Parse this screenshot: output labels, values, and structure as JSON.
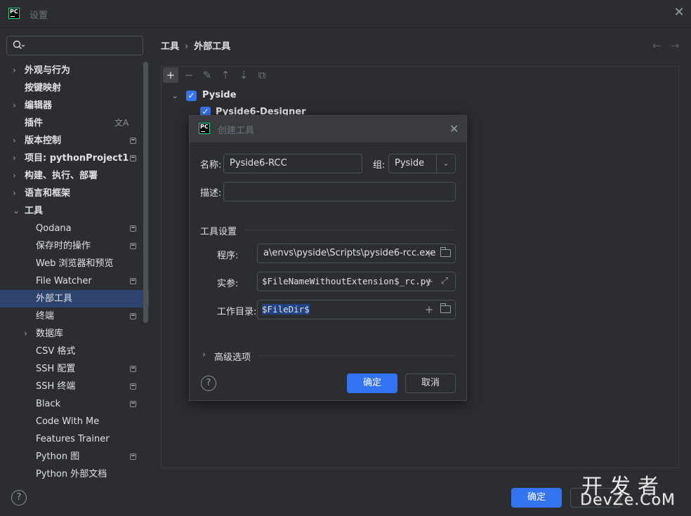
{
  "window": {
    "title": "设置",
    "close_icon": "close-icon"
  },
  "search": {
    "placeholder": "",
    "icon": "search-icon"
  },
  "sidebar": {
    "items": [
      {
        "label": "外观与行为",
        "expandable": true,
        "expanded": false,
        "level": 0
      },
      {
        "label": "按键映射",
        "expandable": false,
        "level": 0
      },
      {
        "label": "编辑器",
        "expandable": true,
        "expanded": false,
        "level": 0
      },
      {
        "label": "插件",
        "expandable": false,
        "level": 0,
        "icon": "translate-icon"
      },
      {
        "label": "版本控制",
        "expandable": true,
        "expanded": false,
        "level": 0,
        "badge": true
      },
      {
        "label": "项目: pythonProject1",
        "expandable": true,
        "expanded": false,
        "level": 0,
        "badge": true
      },
      {
        "label": "构建、执行、部署",
        "expandable": true,
        "expanded": false,
        "level": 0
      },
      {
        "label": "语言和框架",
        "expandable": true,
        "expanded": false,
        "level": 0
      },
      {
        "label": "工具",
        "expandable": true,
        "expanded": true,
        "level": 0
      },
      {
        "label": "Qodana",
        "level": 1,
        "badge": true
      },
      {
        "label": "保存时的操作",
        "level": 1,
        "badge": true
      },
      {
        "label": "Web 浏览器和预览",
        "level": 1
      },
      {
        "label": "File Watcher",
        "level": 1,
        "badge": true
      },
      {
        "label": "外部工具",
        "level": 1,
        "selected": true
      },
      {
        "label": "终端",
        "level": 1,
        "badge": true
      },
      {
        "label": "数据库",
        "level": 1,
        "expandable": true,
        "expanded": false
      },
      {
        "label": "CSV 格式",
        "level": 1
      },
      {
        "label": "SSH 配置",
        "level": 1,
        "badge": true
      },
      {
        "label": "SSH 终端",
        "level": 1,
        "badge": true
      },
      {
        "label": "Black",
        "level": 1,
        "badge": true
      },
      {
        "label": "Code With Me",
        "level": 1
      },
      {
        "label": "Features Trainer",
        "level": 1
      },
      {
        "label": "Python 图",
        "level": 1,
        "badge": true
      },
      {
        "label": "Python 外部文档",
        "level": 1
      }
    ]
  },
  "breadcrumb": {
    "parent": "工具",
    "current": "外部工具"
  },
  "toolbar": {
    "add": "+",
    "remove": "−",
    "edit": "✎",
    "up": "⇡",
    "down": "⇣",
    "copy": "⧉"
  },
  "tools_tree": {
    "group": {
      "label": "Pyside",
      "checked": true,
      "expanded": true
    },
    "children": [
      {
        "label": "Pyside6-Designer",
        "checked": true
      }
    ]
  },
  "dialog": {
    "title": "创建工具",
    "name_label": "名称:",
    "name_value": "Pyside6-RCC",
    "group_label": "组:",
    "group_value": "Pyside",
    "desc_label": "描述:",
    "desc_value": "",
    "section_title": "工具设置",
    "program_label": "程序:",
    "program_value": "a\\envs\\pyside\\Scripts\\pyside6-rcc.exe",
    "args_label": "实参:",
    "args_value": "$FileNameWithoutExtension$_rc.py",
    "workdir_label": "工作目录:",
    "workdir_value": "$FileDir$",
    "advanced_label": "高级选项",
    "ok_label": "确定",
    "cancel_label": "取消",
    "help_label": "?"
  },
  "footer": {
    "ok_label": "确定",
    "help_label": "?"
  },
  "watermark": {
    "cn": "开发者",
    "en": "DevZe.CoM"
  }
}
